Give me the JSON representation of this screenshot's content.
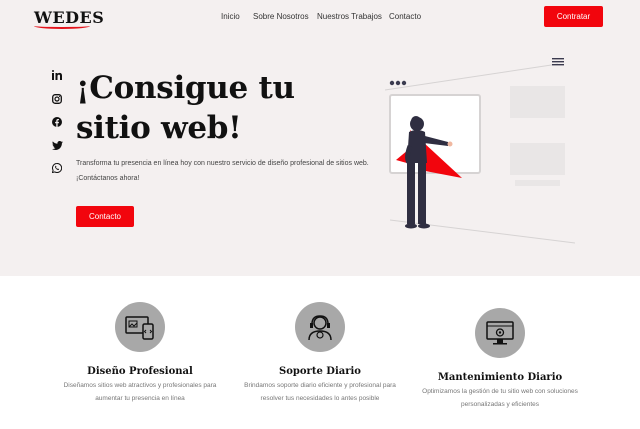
{
  "header": {
    "logo_text": "WEDES",
    "nav": [
      "Inicio",
      "Sobre Nosotros",
      "Nuestros Trabajos",
      "Contacto"
    ],
    "cta_label": "Contratar"
  },
  "hero": {
    "title": "¡Consigue tu sitio web!",
    "description": "Transforma tu presencia en línea hoy con nuestro servicio de diseño profesional de sitios web. ¡Contáctanos ahora!",
    "button_label": "Contacto",
    "social_icons": [
      "linkedin-icon",
      "instagram-icon",
      "facebook-icon",
      "twitter-icon",
      "whatsapp-icon"
    ]
  },
  "features": [
    {
      "title": "Diseño Profesional",
      "description": "Diseñamos sitios web atractivos y profesionales para aumentar tu presencia en línea",
      "icon": "web-design-icon"
    },
    {
      "title": "Soporte Diario",
      "description": "Brindamos soporte diario eficiente y profesional para resolver tus necesidades lo antes posible",
      "icon": "support-agent-icon"
    },
    {
      "title": "Mantenimiento Diario",
      "description": "Optimizamos la gestión de tu sitio web con soluciones personalizadas y eficientes",
      "icon": "monitor-settings-icon"
    }
  ],
  "colors": {
    "accent": "#f2050d",
    "hero_bg": "#f4f0f0",
    "icon_circle": "#a8a8a8"
  }
}
